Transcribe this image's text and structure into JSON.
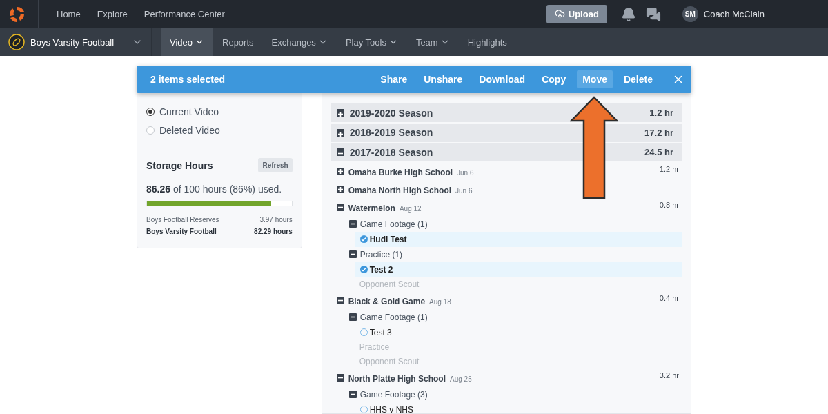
{
  "top_nav": {
    "items": [
      {
        "label": "Home"
      },
      {
        "label": "Explore"
      },
      {
        "label": "Performance Center"
      }
    ],
    "upload": {
      "label": "Upload"
    },
    "user": {
      "initials": "SM",
      "name": "Coach McClain"
    }
  },
  "sub_nav": {
    "team": "Boys Varsity Football",
    "tabs": [
      {
        "label": "Video",
        "selected": true,
        "has_menu": true
      },
      {
        "label": "Reports",
        "selected": false,
        "has_menu": false
      },
      {
        "label": "Exchanges",
        "selected": false,
        "has_menu": true
      },
      {
        "label": "Play Tools",
        "selected": false,
        "has_menu": true
      },
      {
        "label": "Team",
        "selected": false,
        "has_menu": true
      },
      {
        "label": "Highlights",
        "selected": false,
        "has_menu": false
      }
    ]
  },
  "selection_bar": {
    "count": "2 items selected",
    "actions": [
      {
        "label": "Share",
        "selected": false
      },
      {
        "label": "Unshare",
        "selected": false
      },
      {
        "label": "Download",
        "selected": false
      },
      {
        "label": "Copy",
        "selected": false
      },
      {
        "label": "Move",
        "selected": true
      },
      {
        "label": "Delete",
        "selected": false
      }
    ]
  },
  "sidebar": {
    "views": [
      {
        "label": "Current Video",
        "selected": true
      },
      {
        "label": "Deleted Video",
        "selected": false
      }
    ],
    "storage": {
      "title": "Storage Hours",
      "refresh": "Refresh",
      "usage": "**86.26** of 100 hours (86%) used.",
      "level": 0.86,
      "teams": [
        {
          "name": "Boys Football Reserves",
          "hours": "3.97 hours",
          "current": false
        },
        {
          "name": "Boys Varsity Football",
          "hours": "82.29 hours",
          "current": true
        }
      ]
    }
  },
  "seasons": [
    {
      "label": "2019-2020 Season",
      "hours": "1.2 hr",
      "expanded": false
    },
    {
      "label": "2018-2019 Season",
      "hours": "17.2 hr",
      "expanded": false
    },
    {
      "label": "2017-2018 Season",
      "hours": "24.5 hr",
      "expanded": true,
      "children": [
        {
          "name": "Omaha Burke High School",
          "date": "Jun 6",
          "hours": "1.2 hr",
          "expanded": false
        },
        {
          "name": "Omaha North High School",
          "date": "Jun 6",
          "expanded": false
        },
        {
          "name": "Watermelon",
          "date": "Aug 12",
          "hours": "0.8 hr",
          "expanded": true,
          "children": [
            {
              "name": "Game Footage (1)",
              "kind": "folder",
              "children": [
                {
                  "name": "Hudl Test",
                  "selected": true
                }
              ]
            },
            {
              "name": "Practice (1)",
              "kind": "folder",
              "children": [
                {
                  "name": "Test 2",
                  "selected": true
                }
              ]
            },
            {
              "name": "Opponent Scout",
              "kind": "empty"
            }
          ]
        },
        {
          "name": "Black & Gold Game",
          "date": "Aug 18",
          "hours": "0.4 hr",
          "expanded": true,
          "children": [
            {
              "name": "Game Footage (1)",
              "kind": "folder",
              "children": [
                {
                  "name": "Test 3",
                  "selected": false
                }
              ]
            },
            {
              "name": "Practice",
              "kind": "empty"
            },
            {
              "name": "Opponent Scout",
              "kind": "empty"
            }
          ]
        },
        {
          "name": "North Platte High School",
          "date": "Aug 25",
          "hours": "3.2 hr",
          "expanded": true,
          "children": [
            {
              "name": "Game Footage (3)",
              "kind": "folder",
              "children": [
                {
                  "name": "HHS v NHS",
                  "selected": false
                }
              ]
            }
          ]
        }
      ]
    }
  ]
}
